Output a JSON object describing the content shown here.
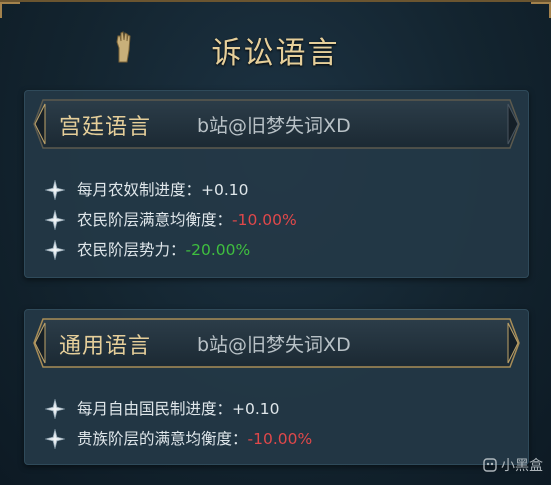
{
  "title": "诉讼语言",
  "cards": [
    {
      "name": "宫廷语言",
      "credit": "b站@旧梦失词XD",
      "effects": [
        {
          "label": "每月农奴制进度：",
          "value": "+0.10",
          "tone": "neutral"
        },
        {
          "label": "农民阶层满意均衡度：",
          "value": "-10.00%",
          "tone": "negative"
        },
        {
          "label": "农民阶层势力：",
          "value": "-20.00%",
          "tone": "positive"
        }
      ]
    },
    {
      "name": "通用语言",
      "credit": "b站@旧梦失词XD",
      "effects": [
        {
          "label": "每月自由国民制进度：",
          "value": "+0.10",
          "tone": "neutral"
        },
        {
          "label": "贵族阶层的满意均衡度：",
          "value": "-10.00%",
          "tone": "negative"
        }
      ]
    }
  ],
  "watermark": "小黑盒",
  "colors": {
    "accent_gold": "#e6cf9a",
    "negative": "#e0484a",
    "positive": "#3fbf3f"
  },
  "icons": {
    "title": "hand-icon",
    "bullet": "star-icon",
    "watermark": "xiaoheihe-logo-icon"
  }
}
